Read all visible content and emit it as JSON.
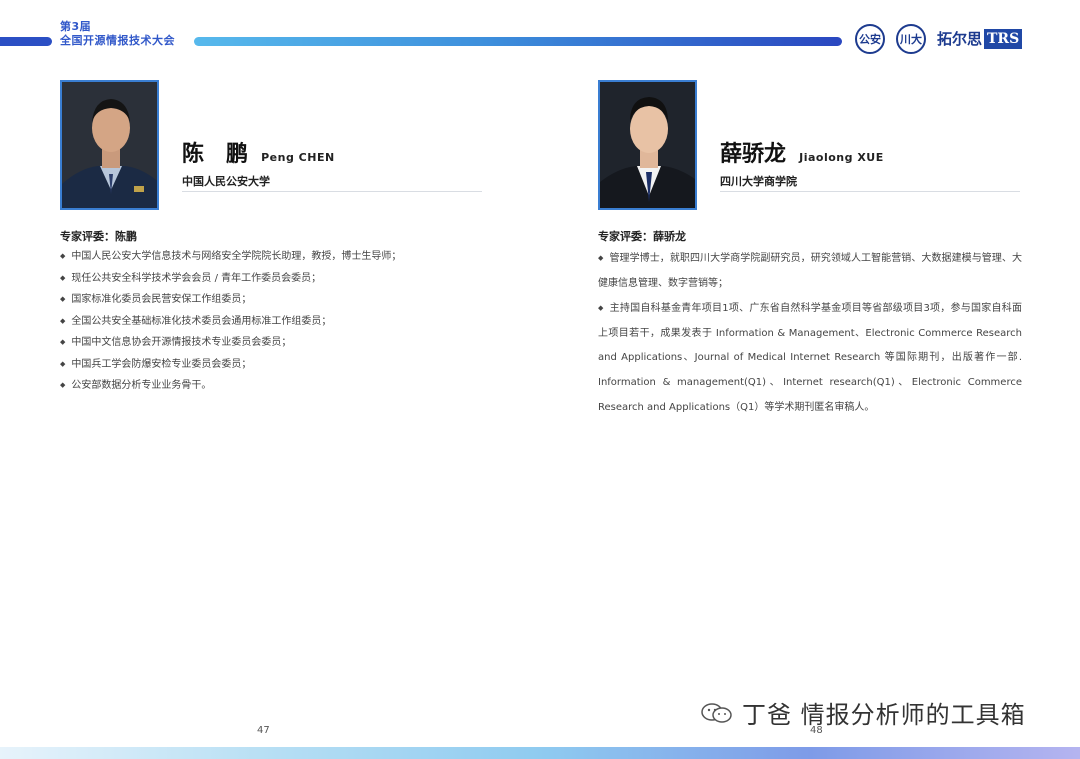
{
  "header": {
    "edition": "第3届",
    "conference": "全国开源情报技术大会",
    "logos": [
      {
        "name": "ppsuc-logo",
        "text": "公安"
      },
      {
        "name": "scu-logo",
        "text": "川大"
      },
      {
        "name": "trs-logo",
        "script": "拓尔思",
        "text": "TRS"
      }
    ],
    "colors": {
      "accent": "#3158c9",
      "bar_start": "#57b9ec",
      "bar_end": "#2a47c0"
    }
  },
  "left": {
    "name_zh": "陈　鹏",
    "name_en": "Peng CHEN",
    "affiliation": "中国人民公安大学",
    "review_title": "专家评委：陈鹏",
    "bullets": [
      "中国人民公安大学信息技术与网络安全学院院长助理，教授，博士生导师；",
      "现任公共安全科学技术学会会员 / 青年工作委员会委员；",
      "国家标准化委员会民营安保工作组委员；",
      "全国公共安全基础标准化技术委员会通用标准工作组委员；",
      "中国中文信息协会开源情报技术专业委员会委员；",
      "中国兵工学会防爆安检专业委员会委员；",
      "公安部数据分析专业业务骨干。"
    ],
    "page_number": "47"
  },
  "right": {
    "name_zh": "薛骄龙",
    "name_en": "Jiaolong XUE",
    "affiliation": "四川大学商学院",
    "review_title": "专家评委：薛骄龙",
    "bullets": [
      "管理学博士，就职四川大学商学院副研究员，研究领域人工智能营销、大数据建模与管理、大健康信息管理、数字营销等；",
      "主持国自科基金青年项目1项、广东省自然科学基金项目等省部级项目3项，参与国家自科面上项目若干，成果发表于 Information & Management、Electronic Commerce Research and Applications、Journal of Medical Internet Research 等国际期刊，出版著作一部. Information & management(Q1)、Internet research(Q1)、Electronic Commerce Research and Applications（Q1）等学术期刊匿名审稿人。"
    ],
    "page_number": "48"
  },
  "watermark": {
    "text": "丁爸 情报分析师的工具箱",
    "icon": "wechat-icon"
  }
}
